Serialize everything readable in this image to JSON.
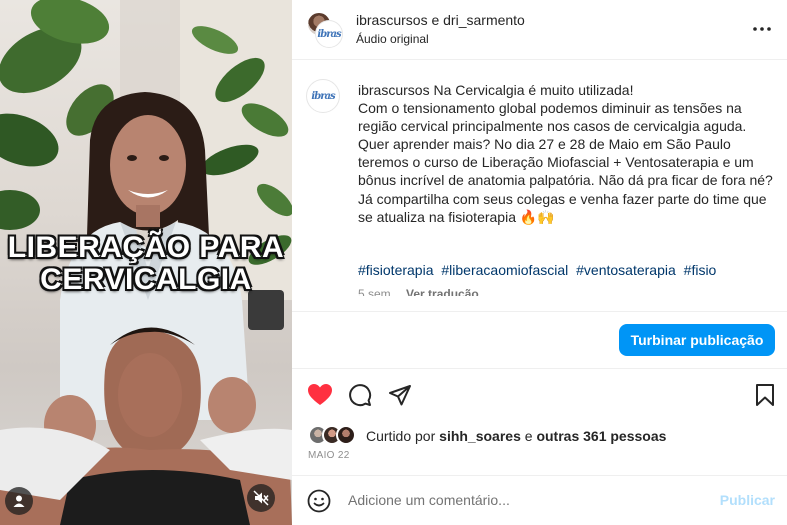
{
  "media": {
    "overlay_line1": "LIBERAÇÃO PARA",
    "overlay_line2": "CERVICALGIA",
    "icons": {
      "user": "user-icon",
      "mute": "speaker-muted-icon"
    }
  },
  "header": {
    "account_names": "ibrascursos e dri_sarmento",
    "audio_label": "Áudio original",
    "more_icon": "more-horizontal-icon",
    "logo_text": "ibras"
  },
  "caption": {
    "username": "ibrascursos",
    "lines": [
      " Na Cervicalgia é muito utilizada!",
      "Com o tensionamento global podemos diminuir as tensões na região cervical principalmente nos casos de cervicalgia aguda. Quer aprender mais? No dia 27 e 28 de Maio em São Paulo teremos o curso de Liberação Miofascial + Ventosaterapia e um bônus incrível de anatomia palpatória. Não dá pra ficar de fora né?",
      "Já compartilha com seus colegas e venha fazer parte do time que se atualiza na fisioterapia 🔥🙌"
    ],
    "hashtags": [
      "#fisioterapia",
      "#liberacaomiofascial",
      "#ventosaterapia",
      "#fisio"
    ],
    "time_ago": "5 sem",
    "translate_label": "Ver tradução"
  },
  "boost_button": {
    "label": "Turbinar publicação",
    "color": "#0095f6"
  },
  "actions": {
    "icons": [
      "heart-filled-icon",
      "comment-icon",
      "share-icon",
      "bookmark-icon"
    ],
    "like_color": "#ff3040"
  },
  "likes": {
    "prefix": "Curtido por ",
    "user": "sihh_soares",
    "middle": " e ",
    "others": "outras 361 pessoas"
  },
  "date": "MAIO 22",
  "comment_box": {
    "emoji_icon": "emoji-smile-icon",
    "placeholder": "Adicione um comentário...",
    "post_label": "Publicar"
  }
}
